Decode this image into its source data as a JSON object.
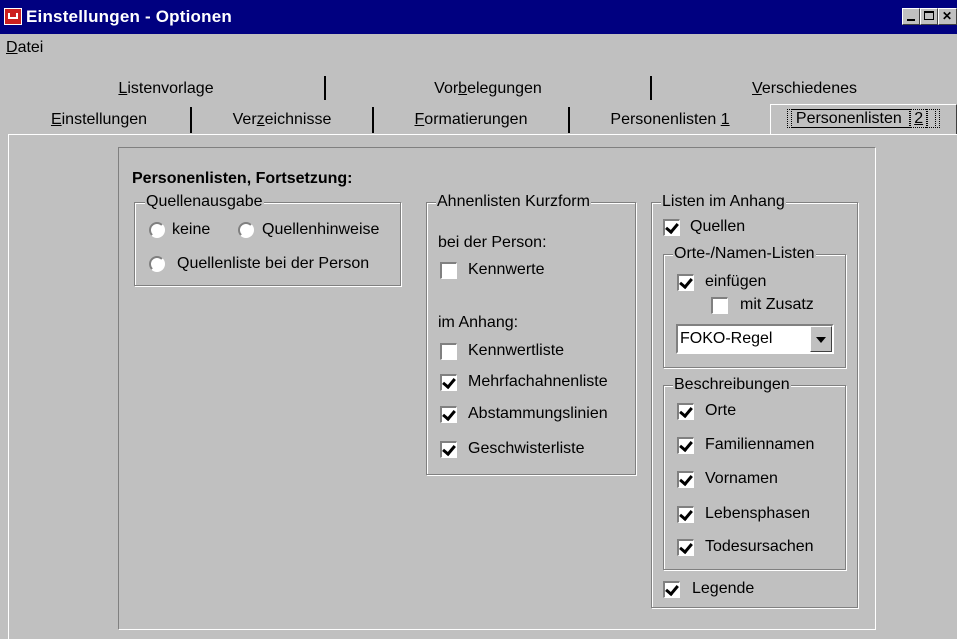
{
  "window": {
    "title": "Einstellungen - Optionen"
  },
  "menu": {
    "datei_mnemonic": "D",
    "datei_rest": "atei"
  },
  "tabs_row1": [
    {
      "pre": "",
      "mn": "L",
      "post": "istenvorlage"
    },
    {
      "pre": "Vor",
      "mn": "b",
      "post": "elegungen"
    },
    {
      "pre": "",
      "mn": "V",
      "post": "erschiedenes"
    }
  ],
  "tabs_row2": [
    {
      "pre": "",
      "mn": "E",
      "post": "instellungen"
    },
    {
      "pre": "Ver",
      "mn": "z",
      "post": "eichnisse"
    },
    {
      "pre": "",
      "mn": "F",
      "post": "ormatierungen"
    },
    {
      "pre": "Personenlisten ",
      "mn": "1",
      "post": ""
    },
    {
      "pre": "Personenlisten ",
      "mn": "2",
      "post": "",
      "active": true
    }
  ],
  "heading": "Personenlisten, Fortsetzung:",
  "quellenausgabe": {
    "legend": "Quellenausgabe",
    "options": [
      "keine",
      "Quellenhinweise",
      "Quellenliste bei der Person"
    ]
  },
  "ahnenlisten": {
    "legend": "Ahnenlisten Kurzform",
    "bei_person_label": "bei der Person:",
    "kennwerte": {
      "label": "Kennwerte",
      "checked": false
    },
    "im_anhang_label": "im Anhang:",
    "kennwertliste": {
      "label": "Kennwertliste",
      "checked": false
    },
    "mehrfachahnenliste": {
      "label": "Mehrfachahnenliste",
      "checked": true
    },
    "abstammungslinien": {
      "label": "Abstammungslinien",
      "checked": true
    },
    "geschwisterliste": {
      "label": "Geschwisterliste",
      "checked": true
    }
  },
  "listen_anhang": {
    "legend": "Listen im Anhang",
    "quellen": {
      "label": "Quellen",
      "checked": true
    },
    "orte_namen": {
      "legend": "Orte-/Namen-Listen",
      "einfuegen": {
        "label": "einfügen",
        "checked": true
      },
      "mit_zusatz": {
        "label": "mit Zusatz",
        "checked": false
      },
      "select_value": "FOKO-Regel"
    },
    "beschreibungen": {
      "legend": "Beschreibungen",
      "items": [
        {
          "label": "Orte",
          "checked": true
        },
        {
          "label": "Familiennamen",
          "checked": true
        },
        {
          "label": "Vornamen",
          "checked": true
        },
        {
          "label": "Lebensphasen",
          "checked": true
        },
        {
          "label": "Todesursachen",
          "checked": true
        }
      ]
    },
    "legende": {
      "label": "Legende",
      "checked": true
    }
  }
}
